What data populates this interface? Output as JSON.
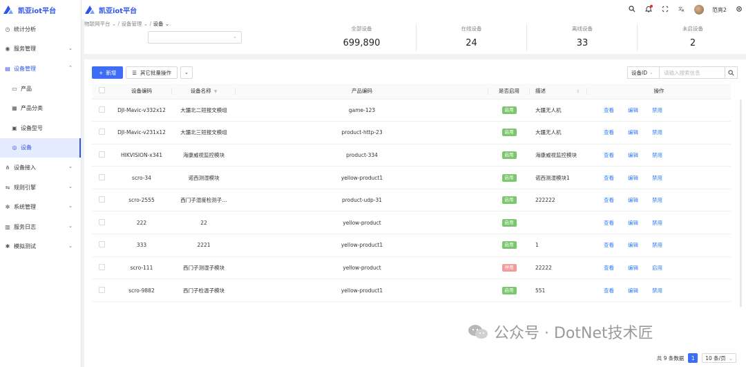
{
  "app": {
    "title": "凯亚iot平台"
  },
  "colors": {
    "accent": "#2f54eb",
    "primary": "#3d6cf5",
    "enabled": "#7cc76e",
    "disabled": "#f29b9b",
    "link": "#2f7df6"
  },
  "sidebar": {
    "items": [
      {
        "label": "统计分析",
        "icon": "clock-icon"
      },
      {
        "label": "服务管理",
        "icon": "eye-icon",
        "chevron": "⌄"
      },
      {
        "label": "设备管理",
        "icon": "device-icon",
        "chevron": "⌃"
      },
      {
        "label": "产品",
        "icon": "monitor-icon"
      },
      {
        "label": "产品分类",
        "icon": "grid-icon"
      },
      {
        "label": "设备型号",
        "icon": "chip-icon"
      },
      {
        "label": "设备",
        "icon": "target-icon"
      },
      {
        "label": "设备接入",
        "icon": "network-icon",
        "chevron": "⌄"
      },
      {
        "label": "规则引擎",
        "icon": "share-icon",
        "chevron": "⌄"
      },
      {
        "label": "系统管理",
        "icon": "gear-icon",
        "chevron": "⌄"
      },
      {
        "label": "服务日志",
        "icon": "log-icon",
        "chevron": "⌄"
      },
      {
        "label": "模拟测试",
        "icon": "bug-icon",
        "chevron": "⌄"
      }
    ]
  },
  "header": {
    "user_name": "范亮2",
    "icons": [
      "search-icon",
      "bell-icon",
      "fullscreen-icon",
      "translate-icon",
      "avatar",
      "settings-icon"
    ]
  },
  "breadcrumb": {
    "items": [
      "物联网平台",
      "设备管理",
      "设备"
    ],
    "sep": "/"
  },
  "stats": [
    {
      "label": "全部设备",
      "value": "699,890"
    },
    {
      "label": "在线设备",
      "value": "24"
    },
    {
      "label": "离线设备",
      "value": "33"
    },
    {
      "label": "未启设备",
      "value": "2"
    }
  ],
  "toolbar": {
    "add_label": "新增",
    "add_icon": "+",
    "batch_label": "其它批量操作",
    "menu_icon": "☰",
    "more_icon": "⌄"
  },
  "search": {
    "field_label": "设备ID",
    "placeholder": "请输入搜索信息",
    "icon": "search-icon"
  },
  "table": {
    "headers": [
      "设备编码",
      "设备名称",
      "产品编码",
      "是否启用",
      "描述",
      "操作"
    ],
    "rows": [
      {
        "code": "DJI-Mavic-v332x12",
        "name": "大疆北二短报文模组",
        "product": "game-123",
        "status": "启用",
        "enabled": true,
        "desc": "大疆无人机"
      },
      {
        "code": "DJI-Mavic-v231x12",
        "name": "大疆北三短报文模组",
        "product": "product-http-23",
        "status": "启用",
        "enabled": true,
        "desc": "大疆无人机"
      },
      {
        "code": "HIKVISION-x341",
        "name": "海康威视监控模块",
        "product": "product-334",
        "status": "启用",
        "enabled": true,
        "desc": "海康威视监控模块"
      },
      {
        "code": "scro-34",
        "name": "诺西测湿模块",
        "product": "yellow-product1",
        "status": "启用",
        "enabled": true,
        "desc": "诺西测湿模块1"
      },
      {
        "code": "scro-2555",
        "name": "西门子湿度检测子…",
        "product": "product-udp-31",
        "status": "启用",
        "enabled": true,
        "desc": "222222"
      },
      {
        "code": "222",
        "name": "22",
        "product": "yellow-product",
        "status": "启用",
        "enabled": true,
        "desc": ""
      },
      {
        "code": "333",
        "name": "2221",
        "product": "yellow-product1",
        "status": "启用",
        "enabled": true,
        "desc": "1"
      },
      {
        "code": "scro-111",
        "name": "西门子测湿子模块",
        "product": "yellow-product",
        "status": "停用",
        "enabled": false,
        "desc": "22222"
      },
      {
        "code": "scro-9882",
        "name": "西门子检温子模块",
        "product": "yellow-product1",
        "status": "启用",
        "enabled": true,
        "desc": "551"
      }
    ],
    "actions": {
      "view": "查看",
      "edit": "编辑",
      "disable": "禁用",
      "enable": "启用"
    }
  },
  "watermark": {
    "text": "公众号 · DotNet技术匠"
  },
  "pagination": {
    "total_text": "共 9 条数据",
    "current": "1",
    "page_size": "10 条/页"
  }
}
